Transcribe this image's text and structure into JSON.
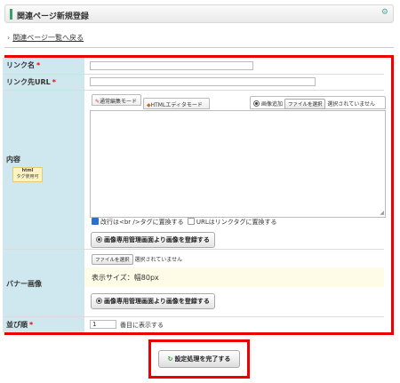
{
  "header": {
    "title": "関連ページ新規登録"
  },
  "back_link": {
    "label": "関連ページ一覧へ戻る"
  },
  "form": {
    "link_name": {
      "label": "リンク名",
      "required_mark": "*",
      "value": ""
    },
    "link_url": {
      "label": "リンク先URL",
      "required_mark": "*",
      "value": ""
    },
    "content": {
      "label": "内容",
      "badge_line1": "html",
      "badge_line2": "タグ使用可",
      "tab_normal": "通常編集モード",
      "tab_html": "HTMLエディタモード",
      "image_add_label": "画像追加",
      "file_button": "ファイルを選択",
      "file_status": "選択されていません",
      "textarea_value": "",
      "checkbox_br_label": "改行は<br />タグに置換する",
      "checkbox_br_checked": true,
      "checkbox_url_label": "URLはリンクタグに置換する",
      "checkbox_url_checked": false,
      "register_image_button": "画像専用管理画面より画像を登録する"
    },
    "banner": {
      "label": "バナー画像",
      "file_button": "ファイルを選択",
      "file_status": "選択されていません",
      "size_text": "表示サイズ：幅80px",
      "register_image_button": "画像専用管理画面より画像を登録する"
    },
    "order": {
      "label": "並び順",
      "required_mark": "*",
      "value": "1",
      "suffix": "番目に表示する"
    }
  },
  "submit": {
    "label": "設定処理を完了する"
  },
  "colors": {
    "accent_green": "#3aa06a",
    "highlight_red": "#ee0000",
    "label_bg": "#cfe7ee"
  }
}
